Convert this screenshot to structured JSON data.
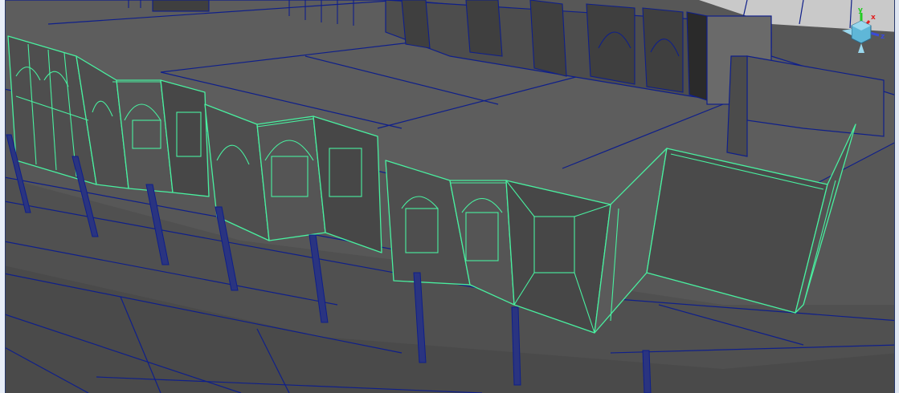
{
  "viewport": {
    "background": "#575757",
    "wireframe_color": "#0f1f8a",
    "selection_color": "#49f0a0",
    "sky_color": "#c9c9c9"
  },
  "view_cube": {
    "icon": "orientation-axes-icon",
    "axes": [
      {
        "label": "y",
        "color": "#22cc22"
      },
      {
        "label": "z",
        "color": "#3a4ad8"
      },
      {
        "label": "x",
        "color": "#e02020"
      }
    ]
  }
}
